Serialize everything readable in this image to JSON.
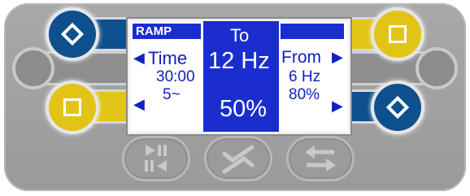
{
  "screen": {
    "mode_label": "RAMP",
    "left": {
      "title": "Time",
      "line2": "30:00",
      "line3": "5~"
    },
    "center": {
      "title": "To",
      "value": "12 Hz",
      "percent": "50%"
    },
    "right": {
      "title": "From",
      "line2": "6 Hz",
      "line3": "80%"
    }
  },
  "controls": {
    "top_left": "diamond-button",
    "bottom_left": "square-button",
    "top_right": "square-button",
    "bottom_right": "diamond-button",
    "bottom_buttons": [
      "play-pause-icon",
      "check-icon",
      "swap-arrows-icon"
    ]
  },
  "colors": {
    "blue": "#0e4f8e",
    "yellow": "#e2c416",
    "screen_blue": "#1a2ed0",
    "panel": "#a0a0a0"
  }
}
